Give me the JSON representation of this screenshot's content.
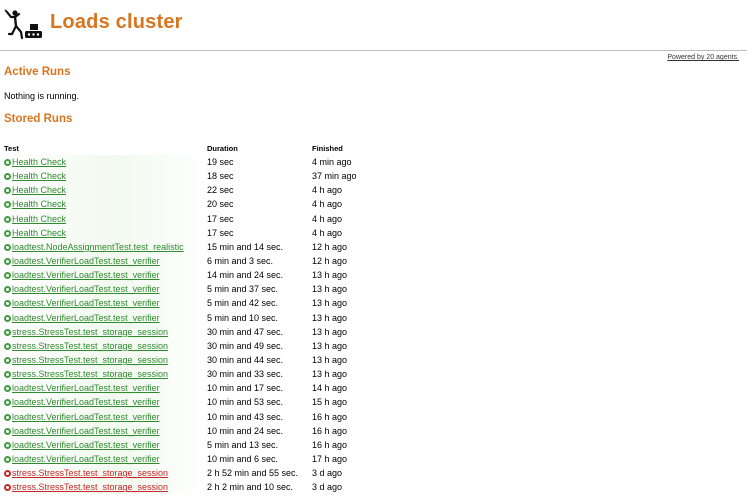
{
  "header": {
    "title": "Loads cluster",
    "powered_by": "Powered by 20 agents."
  },
  "active": {
    "heading": "Active Runs",
    "message": "Nothing is running."
  },
  "stored": {
    "heading": "Stored Runs",
    "columns": [
      "Test",
      "Duration",
      "Finished"
    ],
    "rows": [
      {
        "status": "ok",
        "test": "Health Check",
        "duration": "19 sec",
        "finished": "4 min ago"
      },
      {
        "status": "ok",
        "test": "Health Check",
        "duration": "18 sec",
        "finished": "37 min ago"
      },
      {
        "status": "ok",
        "test": "Health Check",
        "duration": "22 sec",
        "finished": "4 h ago"
      },
      {
        "status": "ok",
        "test": "Health Check",
        "duration": "20 sec",
        "finished": "4 h ago"
      },
      {
        "status": "ok",
        "test": "Health Check",
        "duration": "17 sec",
        "finished": "4 h ago"
      },
      {
        "status": "ok",
        "test": "Health Check",
        "duration": "17 sec",
        "finished": "4 h ago"
      },
      {
        "status": "ok",
        "test": "loadtest.NodeAssignmentTest.test_realistic",
        "duration": "15 min and 14 sec.",
        "finished": "12 h ago"
      },
      {
        "status": "ok",
        "test": "loadtest.VerifierLoadTest.test_verifier",
        "duration": "6 min and 3 sec.",
        "finished": "12 h ago"
      },
      {
        "status": "ok",
        "test": "loadtest.VerifierLoadTest.test_verifier",
        "duration": "14 min and 24 sec.",
        "finished": "13 h ago"
      },
      {
        "status": "ok",
        "test": "loadtest.VerifierLoadTest.test_verifier",
        "duration": "5 min and 37 sec.",
        "finished": "13 h ago"
      },
      {
        "status": "ok",
        "test": "loadtest.VerifierLoadTest.test_verifier",
        "duration": "5 min and 42 sec.",
        "finished": "13 h ago"
      },
      {
        "status": "ok",
        "test": "loadtest.VerifierLoadTest.test_verifier",
        "duration": "5 min and 10 sec.",
        "finished": "13 h ago"
      },
      {
        "status": "ok",
        "test": "stress.StressTest.test_storage_session",
        "duration": "30 min and 47 sec.",
        "finished": "13 h ago"
      },
      {
        "status": "ok",
        "test": "stress.StressTest.test_storage_session",
        "duration": "30 min and 49 sec.",
        "finished": "13 h ago"
      },
      {
        "status": "ok",
        "test": "stress.StressTest.test_storage_session",
        "duration": "30 min and 44 sec.",
        "finished": "13 h ago"
      },
      {
        "status": "ok",
        "test": "stress.StressTest.test_storage_session",
        "duration": "30 min and 33 sec.",
        "finished": "13 h ago"
      },
      {
        "status": "ok",
        "test": "loadtest.VerifierLoadTest.test_verifier",
        "duration": "10 min and 17 sec.",
        "finished": "14 h ago"
      },
      {
        "status": "ok",
        "test": "loadtest.VerifierLoadTest.test_verifier",
        "duration": "10 min and 53 sec.",
        "finished": "15 h ago"
      },
      {
        "status": "ok",
        "test": "loadtest.VerifierLoadTest.test_verifier",
        "duration": "10 min and 43 sec.",
        "finished": "16 h ago"
      },
      {
        "status": "ok",
        "test": "loadtest.VerifierLoadTest.test_verifier",
        "duration": "10 min and 24 sec.",
        "finished": "16 h ago"
      },
      {
        "status": "ok",
        "test": "loadtest.VerifierLoadTest.test_verifier",
        "duration": "5 min and 13 sec.",
        "finished": "16 h ago"
      },
      {
        "status": "ok",
        "test": "loadtest.VerifierLoadTest.test_verifier",
        "duration": "10 min and 6 sec.",
        "finished": "17 h ago"
      },
      {
        "status": "fail",
        "test": "stress.StressTest.test_storage_session",
        "duration": "2 h 52 min and 55 sec.",
        "finished": "3 d ago"
      },
      {
        "status": "fail",
        "test": "stress.StressTest.test_storage_session",
        "duration": "2 h 2 min and 10 sec.",
        "finished": "3 d ago"
      }
    ]
  },
  "colors": {
    "accent": "#d9741f",
    "ok": "#2e8b2e",
    "fail": "#c62828"
  },
  "icons": {
    "logo": "person-lifting-weight-icon",
    "status_ok": "green-circle-icon",
    "status_fail": "red-circle-icon"
  }
}
